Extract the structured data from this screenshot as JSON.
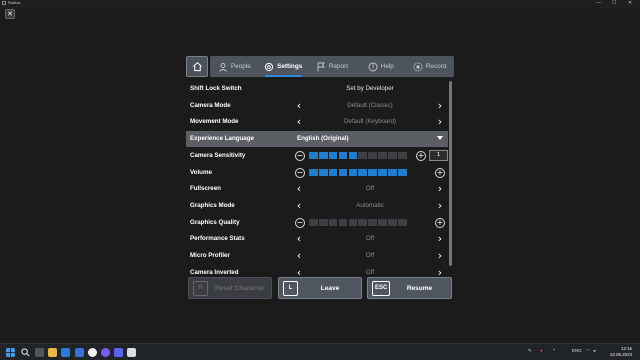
{
  "window": {
    "title": "Roblox",
    "minimize": "—",
    "maximize": "☐",
    "close": "✕"
  },
  "close_game": {
    "glyph": "✕"
  },
  "tabs": [
    {
      "label": "People",
      "icon": "people-icon",
      "active": false
    },
    {
      "label": "Settings",
      "icon": "gear-icon",
      "active": true
    },
    {
      "label": "Report",
      "icon": "flag-icon",
      "active": false
    },
    {
      "label": "Help",
      "icon": "help-icon",
      "active": false
    },
    {
      "label": "Record",
      "icon": "record-icon",
      "active": false
    }
  ],
  "settings": [
    {
      "label": "Shift Lock Switch",
      "value": "Set by Developer",
      "kind": "text"
    },
    {
      "label": "Camera Mode",
      "value": "Default (Classic)",
      "kind": "selector"
    },
    {
      "label": "Movement Mode",
      "value": "Default (Keyboard)",
      "kind": "selector"
    },
    {
      "label": "Experience Language",
      "value": "English (Original)",
      "kind": "dropdown"
    },
    {
      "label": "Camera Sensitivity",
      "kind": "slider",
      "level": 5,
      "max": 10,
      "number": "1"
    },
    {
      "label": "Volume",
      "kind": "slider",
      "level": 10,
      "max": 10
    },
    {
      "label": "Fullscreen",
      "value": "Off",
      "kind": "selector"
    },
    {
      "label": "Graphics Mode",
      "value": "Automatic",
      "kind": "selector"
    },
    {
      "label": "Graphics Quality",
      "kind": "slider",
      "level": 0,
      "max": 10
    },
    {
      "label": "Performance Stats",
      "value": "Off",
      "kind": "selector"
    },
    {
      "label": "Micro Profiler",
      "value": "Off",
      "kind": "selector"
    },
    {
      "label": "Camera Inverted",
      "value": "Off",
      "kind": "selector"
    }
  ],
  "buttons": {
    "reset": {
      "key": "R",
      "label": "Reset Character",
      "disabled": true
    },
    "leave": {
      "key": "L",
      "label": "Leave"
    },
    "resume": {
      "key": "ESC",
      "label": "Resume"
    }
  },
  "taskbar": {
    "lang": "ENG",
    "time": "12:16",
    "date": "22.06.2023"
  },
  "colors": {
    "accent": "#1f7ed0",
    "panel": "#4e545d",
    "background": "#1b1b1b"
  }
}
